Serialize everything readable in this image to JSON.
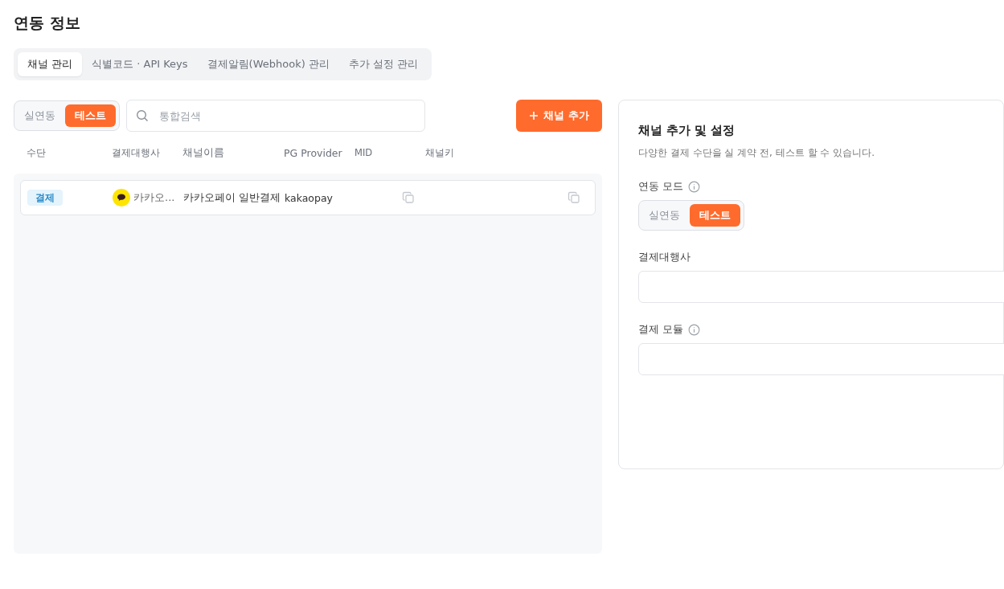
{
  "title": "연동 정보",
  "tabs": [
    {
      "label": "채널 관리",
      "selected": true
    },
    {
      "label": "식별코드 · API Keys",
      "selected": false
    },
    {
      "label": "결제알림(Webhook) 관리",
      "selected": false
    },
    {
      "label": "추가 설정 관리",
      "selected": false
    }
  ],
  "mode_toggle": [
    {
      "label": "실연동",
      "selected": false
    },
    {
      "label": "테스트",
      "selected": true
    }
  ],
  "search": {
    "placeholder": "통합검색"
  },
  "add_button": "채널 추가",
  "table": {
    "columns": [
      "수단",
      "결제대행사",
      "채널이름",
      "PG Provider",
      "MID",
      "채널키"
    ],
    "rows": [
      {
        "method": "결제",
        "pg": "카카오...",
        "channel_name": "카카오페이 일반결제",
        "provider": "kakaopay"
      }
    ]
  },
  "panel": {
    "title": "채널 추가 및 설정",
    "description": "다양한 결제 수단을 실 계약 전, 테스트 할 수 있습니다.",
    "mode_label": "연동 모드",
    "mode_toggle": [
      {
        "label": "실연동",
        "selected": false
      },
      {
        "label": "테스트",
        "selected": true
      }
    ],
    "pg_label": "결제대행사",
    "module_label": "결제 모듈"
  }
}
